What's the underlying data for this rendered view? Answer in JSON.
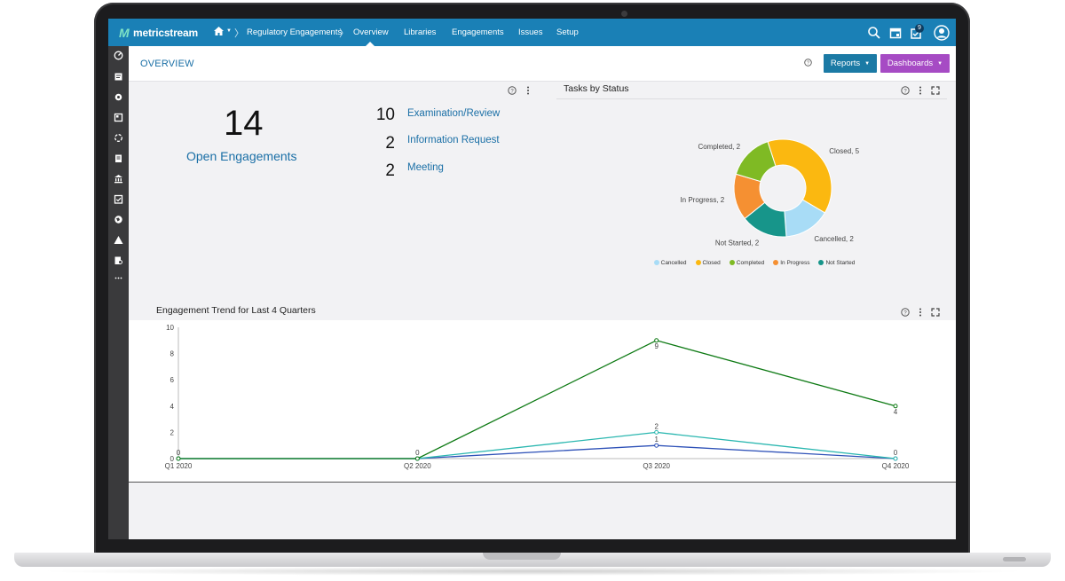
{
  "app": {
    "logo_text": "metricstream",
    "nav": {
      "breadcrumb": "Regulatory Engagements",
      "items": [
        "Overview",
        "Libraries",
        "Engagements",
        "Issues",
        "Setup"
      ],
      "active": "Overview",
      "notification_count": "9"
    }
  },
  "header": {
    "title": "OVERVIEW",
    "reports_label": "Reports",
    "dashboards_label": "Dashboards"
  },
  "kpi": {
    "open_count": "14",
    "open_label": "Open Engagements",
    "types": [
      {
        "count": "10",
        "label": "Examination/Review"
      },
      {
        "count": "2",
        "label": "Information Request"
      },
      {
        "count": "2",
        "label": "Meeting"
      }
    ]
  },
  "tasks": {
    "title": "Tasks by Status",
    "slices": [
      {
        "name": "Closed",
        "value": 5,
        "label": "Closed, 5",
        "color": "#fbb810"
      },
      {
        "name": "Cancelled",
        "value": 2,
        "label": "Cancelled, 2",
        "color": "#a8dcf6"
      },
      {
        "name": "Not Started",
        "value": 2,
        "label": "Not Started, 2",
        "color": "#17958a"
      },
      {
        "name": "In Progress",
        "value": 2,
        "label": "In Progress, 2",
        "color": "#f59032"
      },
      {
        "name": "Completed",
        "value": 2,
        "label": "Completed, 2",
        "color": "#7fba24"
      }
    ],
    "legend": [
      {
        "name": "Cancelled",
        "color": "#a8dcf6"
      },
      {
        "name": "Closed",
        "color": "#fbb810"
      },
      {
        "name": "Completed",
        "color": "#7fba24"
      },
      {
        "name": "In Progress",
        "color": "#f59032"
      },
      {
        "name": "Not Started",
        "color": "#17958a"
      }
    ]
  },
  "trend": {
    "title": "Engagement Trend for Last 4 Quarters"
  },
  "chart_data": [
    {
      "type": "pie",
      "title": "Tasks by Status",
      "categories": [
        "Closed",
        "Cancelled",
        "Not Started",
        "In Progress",
        "Completed"
      ],
      "values": [
        5,
        2,
        2,
        2,
        2
      ],
      "legend": "bottom"
    },
    {
      "type": "line",
      "title": "Engagement Trend for Last 4 Quarters",
      "categories": [
        "Q1 2020",
        "Q2 2020",
        "Q3 2020",
        "Q4 2020"
      ],
      "ylim": [
        0,
        10
      ],
      "yticks": [
        0,
        2,
        4,
        6,
        8,
        10
      ],
      "series": [
        {
          "values": [
            0,
            0,
            9,
            4
          ],
          "color": "#0e7a14",
          "labels": [
            "0",
            "0",
            "9",
            "4"
          ]
        },
        {
          "values": [
            0,
            0,
            2,
            0
          ],
          "color": "#2bb7b0",
          "labels": [
            "",
            "",
            "2",
            "0"
          ]
        },
        {
          "values": [
            0,
            0,
            1,
            0
          ],
          "color": "#2f52b8",
          "labels": [
            "",
            "",
            "1",
            ""
          ]
        }
      ]
    }
  ]
}
